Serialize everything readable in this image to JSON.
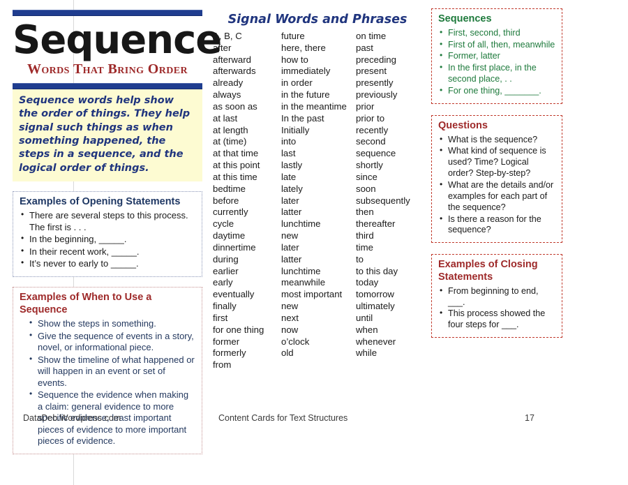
{
  "header": {
    "title": "Sequence",
    "subtitle": "Words That Bring Order",
    "intro": "Sequence words help show the order of things.  They help signal such things as when something happened, the steps in a sequence, and the logical order of things."
  },
  "colors": {
    "rule_bar": "#1f3d8f",
    "navy": "#20357e",
    "dark_red": "#9e2a2a",
    "green": "#1e7a3c",
    "intro_bg": "#fdfbd2"
  },
  "left_panels": [
    {
      "heading": "Examples of Opening Statements",
      "items": [
        "There are several steps to this process. The first is . . .",
        "In the beginning, _____.",
        "In their recent work, _____.",
        "It’s never to early to _____."
      ]
    },
    {
      "heading": "Examples of When to Use a Sequence",
      "items": [
        "Show the steps in something.",
        "Give the sequence of events in a story, novel, or informational piece.",
        "Show the timeline of what happened or will happen in an event or set of events.",
        "Sequence the evidence when making a claim:  general evidence to more specific evidence, least important pieces of evidence to more important pieces of evidence."
      ]
    }
  ],
  "signal_words": {
    "heading": "Signal Words and Phrases",
    "column1": [
      "A, B, C",
      "after",
      "afterward",
      "afterwards",
      "already",
      "always",
      "as soon as",
      "at last",
      "at length",
      "at (time)",
      "at that time",
      "at this point",
      "at this time",
      "bedtime",
      "before",
      "currently",
      "cycle",
      "daytime",
      "dinnertime",
      "during",
      "earlier",
      "early",
      "eventually",
      "finally",
      "first",
      "for one thing",
      "former",
      "formerly",
      "from"
    ],
    "column2": [
      "future",
      "here, there",
      "how to",
      "immediately",
      "in order",
      "in the future",
      "in the meantime",
      "In the past",
      "Initially",
      "into",
      "last",
      "lastly",
      "late",
      "lately",
      "later",
      "latter",
      "lunchtime",
      "new",
      "later",
      "latter",
      "lunchtime",
      "meanwhile",
      "most important",
      "new",
      "next",
      "now",
      "o’clock",
      "old"
    ],
    "column3": [
      "on time",
      "past",
      "preceding",
      "present",
      "presently",
      "previously",
      "prior",
      "prior to",
      "recently",
      "second",
      "sequence",
      "shortly",
      "since",
      "soon",
      "subsequently",
      "then",
      "thereafter",
      "third",
      "time",
      "to",
      "to this day",
      "today",
      "tomorrow",
      "ultimately",
      "until",
      "when",
      "whenever",
      "while"
    ]
  },
  "right_panels": [
    {
      "heading": "Sequences",
      "items": [
        "First, second, third",
        "First of all, then, meanwhile",
        "Former, latter",
        "In the first place, in the second place, . .",
        "For one thing, _______."
      ]
    },
    {
      "heading": "Questions",
      "items": [
        "What is the sequence?",
        "What kind of sequence is used?  Time?  Logical order?  Step-by-step?",
        "What are the details and/or examples for each part of the sequence?",
        "Is there a reason for the sequence?"
      ]
    },
    {
      "heading": "Examples of Closing Statements",
      "items": [
        "From beginning to end, ___.",
        "This process showed the four steps for ___."
      ]
    }
  ],
  "footer": {
    "left": "DataDeb.Wordpress.com",
    "center": "Content Cards for Text Structures",
    "page": "17"
  }
}
